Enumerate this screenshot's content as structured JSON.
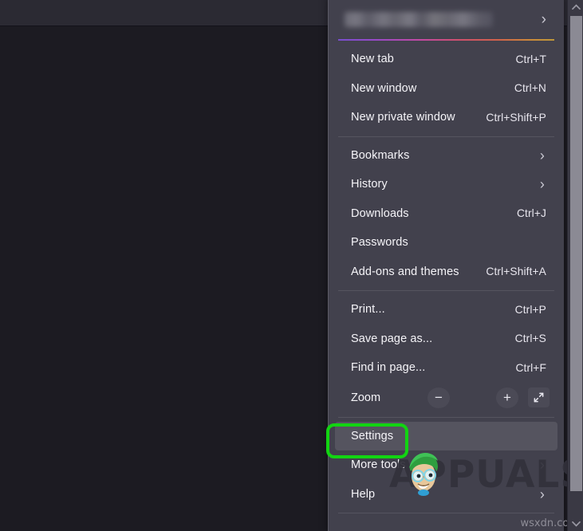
{
  "window": {
    "background_color": "#1c1b22",
    "toolbar_color": "#2b2a33"
  },
  "panel": {
    "background_color": "#42414d",
    "account": {
      "label": "",
      "redacted": true,
      "chevron": "›",
      "icon_name": "chevron-right-icon"
    },
    "gradient_rule_colors": [
      "#7b4fd4",
      "#c94aa8",
      "#d8644a",
      "#c39b3a"
    ],
    "groups": [
      {
        "items": [
          {
            "label": "New tab",
            "accel": "Ctrl+T",
            "type": "accel"
          },
          {
            "label": "New window",
            "accel": "Ctrl+N",
            "type": "accel"
          },
          {
            "label": "New private window",
            "accel": "Ctrl+Shift+P",
            "type": "accel"
          }
        ]
      },
      {
        "items": [
          {
            "label": "Bookmarks",
            "accel": "›",
            "type": "submenu"
          },
          {
            "label": "History",
            "accel": "›",
            "type": "submenu"
          },
          {
            "label": "Downloads",
            "accel": "Ctrl+J",
            "type": "accel"
          },
          {
            "label": "Passwords",
            "accel": "",
            "type": "plain"
          },
          {
            "label": "Add-ons and themes",
            "accel": "Ctrl+Shift+A",
            "type": "accel"
          }
        ]
      },
      {
        "items": [
          {
            "label": "Print...",
            "accel": "Ctrl+P",
            "type": "accel"
          },
          {
            "label": "Save page as...",
            "accel": "Ctrl+S",
            "type": "accel"
          },
          {
            "label": "Find in page...",
            "accel": "Ctrl+F",
            "type": "accel"
          }
        ],
        "zoom": {
          "label": "Zoom",
          "minus": "−",
          "plus": "+",
          "minus_icon": "zoom-out-icon",
          "plus_icon": "zoom-in-icon",
          "fullscreen_icon": "fullscreen-expand-icon"
        }
      },
      {
        "items": [
          {
            "label": "Settings",
            "accel": "",
            "type": "plain",
            "hovered": true
          },
          {
            "label": "More tools",
            "accel": "›",
            "type": "submenu"
          },
          {
            "label": "Help",
            "accel": "›",
            "type": "submenu"
          }
        ]
      }
    ]
  },
  "annotation": {
    "shape": "rounded-rectangle",
    "color": "#12d412",
    "targets": "Settings"
  },
  "watermark": {
    "brand": "APPUALS",
    "site": "wsxdn.com"
  },
  "scrollbar": {
    "up_icon": "chevron-up-icon",
    "down_icon": "chevron-down-icon",
    "thumb_color": "#8b8a94"
  }
}
